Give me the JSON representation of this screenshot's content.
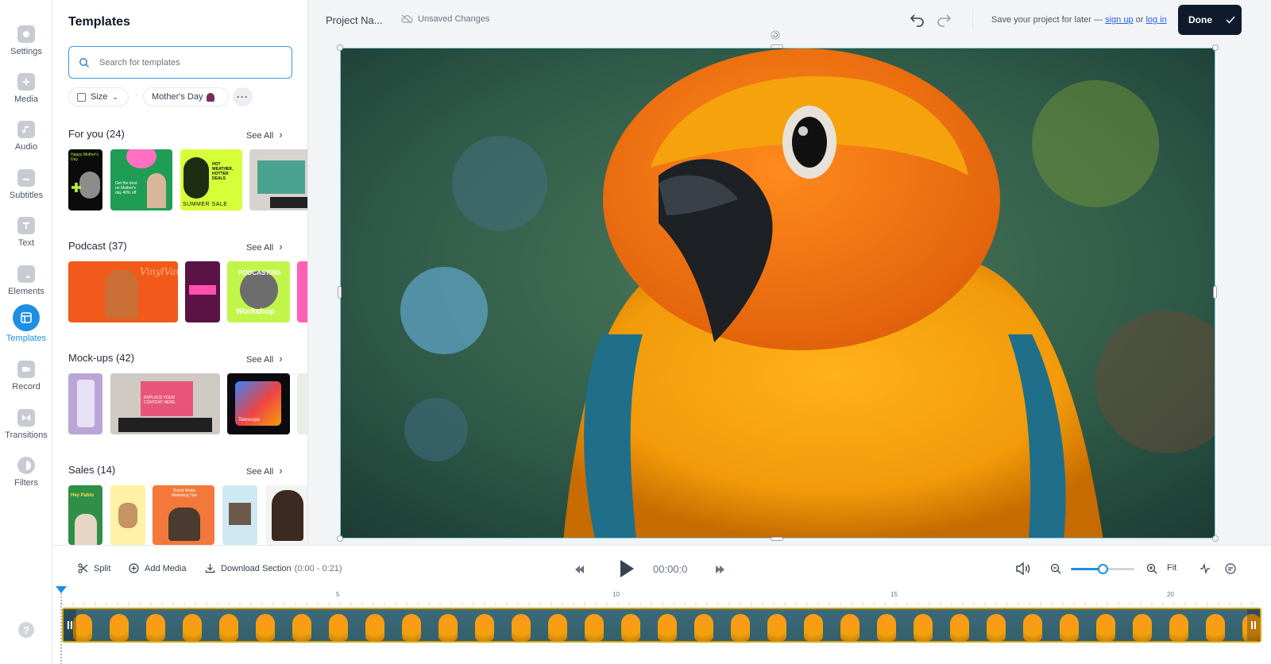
{
  "rail": {
    "items": [
      {
        "label": "Settings",
        "icon": "gear-icon"
      },
      {
        "label": "Media",
        "icon": "plus-icon"
      },
      {
        "label": "Audio",
        "icon": "music-note-icon"
      },
      {
        "label": "Subtitles",
        "icon": "subtitles-icon"
      },
      {
        "label": "Text",
        "icon": "text-icon"
      },
      {
        "label": "Elements",
        "icon": "shapes-icon"
      },
      {
        "label": "Templates",
        "icon": "templates-icon"
      },
      {
        "label": "Record",
        "icon": "camera-icon"
      },
      {
        "label": "Transitions",
        "icon": "transition-icon"
      },
      {
        "label": "Filters",
        "icon": "filter-icon"
      }
    ],
    "active": "Templates",
    "help": "?"
  },
  "panel": {
    "title": "Templates",
    "search_placeholder": "Search for templates",
    "chips": {
      "size": "Size",
      "mothers_day": "Mother's Day",
      "more": "···"
    },
    "see_all": "See All",
    "sections": [
      {
        "title": "For you (24)"
      },
      {
        "title": "Podcast (37)"
      },
      {
        "title": "Mock-ups (42)"
      },
      {
        "title": "Sales (14)"
      }
    ],
    "thumb_text": {
      "happy_mothers_day": "Happy Mother's Day",
      "best_on_mothers_day": "Get the best on Mother's day 40% off",
      "summer_sale": "SUMMER SALE",
      "hot_weather": "HOT WEATHER, HOTTER DEALS",
      "vinyl_vaults": "VinylVaults",
      "podcasting": "PODCASTING",
      "workshop": "Workshop",
      "telescope": "Telescope",
      "replace_content": "REPLACE YOUR CONTENT HERE",
      "hey_pablo": "Hey Pablo",
      "social_media_tips": "Social Media Marketing Tips"
    }
  },
  "topbar": {
    "project_name": "Project Na...",
    "unsaved": "Unsaved Changes",
    "save_prefix": "Save your project for later —",
    "sign_up": "sign up",
    "or": "or",
    "log_in": "log in",
    "done": "Done"
  },
  "timeline": {
    "split": "Split",
    "add_media": "Add Media",
    "download_section": "Download Section",
    "download_range": "(0:00 - 0:21)",
    "time": "00:00:0",
    "fit": "Fit",
    "zoom_level": 0.5,
    "ruler_ticks": [
      "5",
      "10",
      "15",
      "20"
    ]
  },
  "colors": {
    "accent": "#1e8fe3",
    "done_bg": "#0f1b2d",
    "track_border": "#d9a400"
  }
}
